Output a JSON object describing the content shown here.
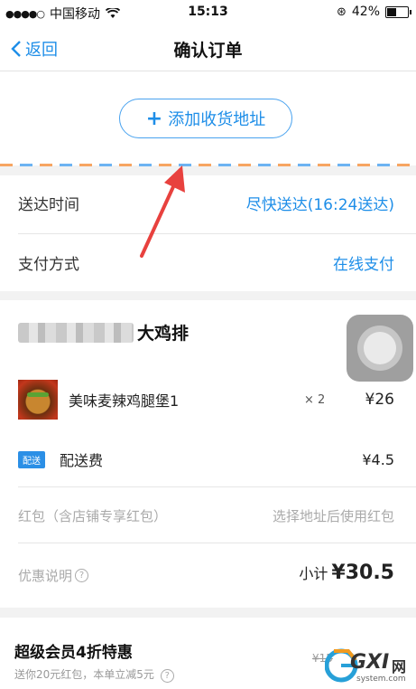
{
  "status_bar": {
    "carrier": "中国移动",
    "time": "15:13",
    "battery": "42%",
    "battery_level": 0.42
  },
  "nav": {
    "back_label": "返回",
    "title": "确认订单"
  },
  "address": {
    "add_label": "添加收货地址"
  },
  "delivery": {
    "label": "送达时间",
    "value": "尽快送达(16:24送达)"
  },
  "payment": {
    "label": "支付方式",
    "value": "在线支付"
  },
  "shop": {
    "name_suffix": "大鸡排"
  },
  "item": {
    "name": "美味麦辣鸡腿堡1",
    "qty": "× 2",
    "price": "¥26"
  },
  "fee": {
    "badge": "配送",
    "label": "配送费",
    "price": "¥4.5"
  },
  "red_packet": {
    "label": "红包（含店铺专享红包）",
    "hint": "选择地址后使用红包"
  },
  "discount": {
    "label": "优惠说明"
  },
  "subtotal": {
    "label": "小计",
    "amount": "¥30.5"
  },
  "vip": {
    "title": "超级会员4折特惠",
    "subtitle": "送你20元红包，本单立减5元",
    "price": "¥15"
  },
  "watermark": {
    "brand": "GXI",
    "net": "网",
    "domain": "system.com"
  },
  "colors": {
    "accent": "#1e8ee8",
    "arrow": "#e8413e"
  }
}
